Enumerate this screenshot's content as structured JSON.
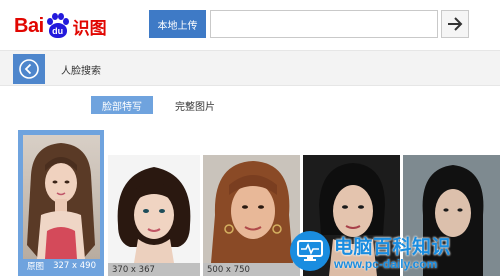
{
  "logo": {
    "latin": "Bai",
    "paw_text": "du",
    "cn": "识图"
  },
  "header": {
    "upload_label": "本地上传",
    "search_value": "",
    "search_placeholder": ""
  },
  "subbar": {
    "title": "人脸搜索"
  },
  "tabs": [
    {
      "label": "脸部特写",
      "active": true
    },
    {
      "label": "完整图片",
      "active": false
    }
  ],
  "thumbnails": [
    {
      "label": "原图",
      "size": "327 x 490",
      "selected": true
    },
    {
      "label": "",
      "size": "370 x 367",
      "selected": false
    },
    {
      "label": "",
      "size": "500 x 750",
      "selected": false
    },
    {
      "label": "",
      "size": "",
      "selected": false
    },
    {
      "label": "",
      "size": "",
      "selected": false
    }
  ],
  "watermark": {
    "cn": "电脑百科知识",
    "url": "www.pc-daily.com"
  },
  "colors": {
    "brand_red": "#e10601",
    "brand_blue": "#2319dc",
    "accent_blue": "#3e7ac6",
    "tab_blue": "#6fa3de",
    "watermark_blue": "#1a8de0"
  },
  "icons": {
    "search": "arrow-right-icon",
    "back": "chevron-left-icon",
    "watermark": "monitor-pulse-icon"
  }
}
